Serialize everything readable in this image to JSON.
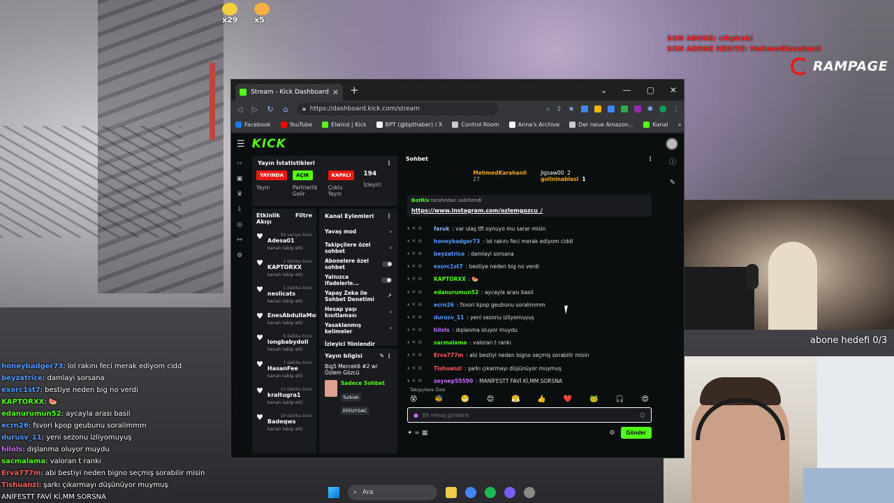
{
  "overlay": {
    "emotes": [
      {
        "count": "x29"
      },
      {
        "count": "x5"
      }
    ],
    "last_sub": "SON ABONE: cihpiraki",
    "last_sub_gift": "SON ABONE HEDIYE: MehmedKarahanli",
    "brand": "RAMPAGE",
    "goal": "abone hedefi 0/3",
    "chat": [
      {
        "user": "honeybadger73",
        "text": ": lol rakını feci merak ediyom cidd",
        "color": "#4f9bff"
      },
      {
        "user": "beyzatrice",
        "text": ": damlayi sorsana",
        "color": "#4f9bff"
      },
      {
        "user": "exorc1st7",
        "text": ": bestiye neden big no verdi",
        "color": "#4f9bff"
      },
      {
        "user": "KAPTORXX",
        "text": ": 🍉",
        "color": "#53fc18"
      },
      {
        "user": "edanurumun52",
        "text": ": aycayla arası basil",
        "color": "#53fc18"
      },
      {
        "user": "ecrn26",
        "text": ": fsvori kpop geubunu soralimmm",
        "color": "#4f9bff"
      },
      {
        "user": "durusv_11",
        "text": ": yeni sezonu izliyomuyuş",
        "color": "#4f9bff"
      },
      {
        "user": "hilols",
        "text": ": dışlanma oluyor muydu",
        "color": "#c86bff"
      },
      {
        "user": "sacmalama",
        "text": ": valoran t rankı",
        "color": "#53fc18"
      },
      {
        "user": "Erva777m",
        "text": ": abi bestiyi neden bigno seçmiş sorabilir misin",
        "color": "#ff5a5a"
      },
      {
        "user": "Tishuanzi",
        "text": ": şarkı çıkarmayı düşünüyor muymuş",
        "color": "#ff5a5a"
      },
      {
        "user": "",
        "text": "ANİFESTT FAVİ Kİ,MM SORSNA",
        "color": "#ffffff"
      }
    ]
  },
  "browser": {
    "tab_title": "Stream - Kick Dashboard",
    "url": "https://dashboard.kick.com/stream",
    "bookmarks": [
      {
        "label": "Facebook",
        "color": "#1877f2"
      },
      {
        "label": "YouTube",
        "color": "#ff0000"
      },
      {
        "label": "Elwind | Kick",
        "color": "#53fc18"
      },
      {
        "label": "BPT (@bpthaber) / X",
        "color": "#ffffff"
      },
      {
        "label": "Control Room",
        "color": "#cccccc"
      },
      {
        "label": "Anna's Archive",
        "color": "#ffffff"
      },
      {
        "label": "Der neue Amazon...",
        "color": "#cccccc"
      },
      {
        "label": "Kanal",
        "color": "#53fc18"
      }
    ]
  },
  "dashboard": {
    "logo": "KICK",
    "stats": {
      "title": "Yayın İstatistikleri",
      "items": [
        {
          "pill": "YAYINDA",
          "label": "Yayın",
          "kind": "red"
        },
        {
          "pill": "AÇIK",
          "label": "Partnerlik Gelir",
          "kind": "green"
        },
        {
          "pill": "KAPALI",
          "label": "Çoklu Yayın",
          "kind": "red"
        },
        {
          "pill": "194",
          "label": "İzleyici",
          "kind": "num"
        }
      ]
    },
    "activity": {
      "title": "Etkinlik Akışı",
      "filter": "Filtre",
      "followers": [
        {
          "name": "Adesa01",
          "time": "54 saniye önce",
          "sub": "kanalı takip etti"
        },
        {
          "name": "KAPTORXX",
          "time": "1 dakika önce",
          "sub": "kanalı takip etti"
        },
        {
          "name": "neslicats",
          "time": "1 dakika önce",
          "sub": "kanalı takip etti"
        },
        {
          "name": "EnesAbdullaMoh",
          "time": "",
          "sub": "kanalı takip etti"
        },
        {
          "name": "longbabydoll",
          "time": "6 dakika önce",
          "sub": "kanalı takip etti"
        },
        {
          "name": "HasanFee",
          "time": "7 dakika önce",
          "sub": "kanalı takip etti"
        },
        {
          "name": "kraltugra1",
          "time": "11 dakika önce",
          "sub": "kanalı takip etti"
        },
        {
          "name": "Badeqws",
          "time": "19 dakika önce",
          "sub": "kanalı takip etti"
        }
      ]
    },
    "actions": {
      "title": "Kanal Eylemleri",
      "items": [
        {
          "label": "Yavaş mod",
          "type": "chevron"
        },
        {
          "label": "Takipçilere özel sohbet",
          "type": "chevron"
        },
        {
          "label": "Abonelere özel sohbet",
          "type": "toggle"
        },
        {
          "label": "Yalnızca ifadelerle...",
          "type": "toggle"
        },
        {
          "label": "Yapay Zeka ile Sohbet Denetimi",
          "type": "link"
        },
        {
          "label": "Hesap yaşı kısıtlaması",
          "type": "chevron"
        },
        {
          "label": "Yasaklanmış kelimeler",
          "type": "chevron"
        },
        {
          "label": "İzleyici Yönlendir",
          "type": "none"
        }
      ]
    },
    "info": {
      "title": "Yayın bilgisi",
      "stream_title": "Big5 Mercek6 #2 w/ Özlem Gözcü",
      "category": "Sadece Sohbet",
      "tags": [
        "Turkish",
        "EFEUYGAC"
      ]
    },
    "chat": {
      "title": "Sohbet",
      "leaders": [
        {
          "name": "MehmedKarahanli",
          "count": "27"
        },
        {
          "name": "Jigsaw00",
          "count": "2"
        },
        {
          "name": "golininablasi",
          "count": "1"
        }
      ],
      "pinned_by": "BotRix",
      "pinned_note": "tarafından sabitlendi",
      "pinned_link": "https://www.instagram.com/ozlemgozcu_/",
      "messages": [
        {
          "user": "faruk",
          "text": ": var ulaş tft oynuyo mu sarar misin",
          "color": "#8ab4f8"
        },
        {
          "user": "honeybadger73",
          "text": ": lol rakını feci merak ediyom ciddi",
          "color": "#4f9bff"
        },
        {
          "user": "beyzatrice",
          "text": ": damlayi sorsana",
          "color": "#4f9bff"
        },
        {
          "user": "exorc1st7",
          "text": ": bestiye neden big no verdi",
          "color": "#4f9bff"
        },
        {
          "user": "KAPTORXX",
          "text": ": 🍉",
          "color": "#53fc18"
        },
        {
          "user": "edanurumun52",
          "text": ": aycayla arası basil",
          "color": "#53fc18"
        },
        {
          "user": "ecrn26",
          "text": ": fsvori kpop geubunu soralimmm",
          "color": "#4f9bff"
        },
        {
          "user": "durusv_11",
          "text": ": yeni sezonu izliyomuyuş",
          "color": "#4f9bff"
        },
        {
          "user": "hilols",
          "text": ": dışlanma oluyor muydu",
          "color": "#c86bff"
        },
        {
          "user": "sacmalama",
          "text": ": valoran t rankı",
          "color": "#53fc18"
        },
        {
          "user": "Erva777m",
          "text": ": abi bestiyi neden bigno seçmiş sorabilir misin",
          "color": "#ff5a5a"
        },
        {
          "user": "Tishuanzi",
          "text": ": şarkı çıkarmayı düşünüyor muymuş",
          "color": "#ff5a5a"
        },
        {
          "user": "zeynep55590",
          "text": ": MANİFESTT FAVİ Kİ,MM SORSNA",
          "color": "#c86bff"
        }
      ],
      "followers_only": "Takipçilere Özel",
      "emotes": [
        "😵",
        "🐝",
        "😬",
        "😊",
        "😤",
        "👍",
        "❤️",
        "🐸",
        "🎧",
        "😍"
      ],
      "placeholder": "Bir mesaj gönderin",
      "send": "Gönder"
    }
  },
  "taskbar": {
    "search": "Ara"
  }
}
